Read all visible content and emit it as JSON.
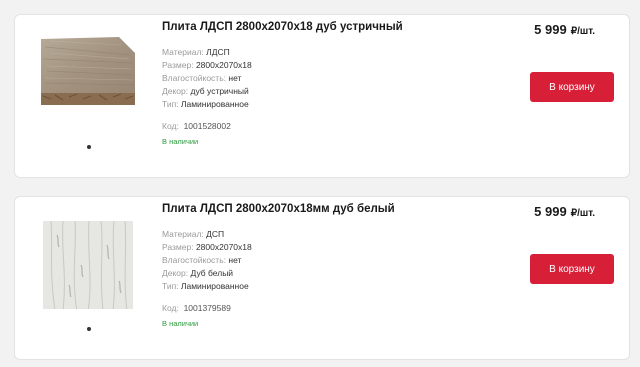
{
  "products": [
    {
      "title": "Плита ЛДСП 2800х2070х18 дуб устричный",
      "specs": [
        {
          "key": "Материал:",
          "value": "ЛДСП"
        },
        {
          "key": "Размер:",
          "value": "2800х2070х18"
        },
        {
          "key": "Влагостойкость:",
          "value": "нет"
        },
        {
          "key": "Декор:",
          "value": "дуб устричный"
        },
        {
          "key": "Тип:",
          "value": "Ламинированное"
        }
      ],
      "code_label": "Код:",
      "code_value": "1001528002",
      "stock": "В наличии",
      "price": "5 999",
      "unit": "₽/шт.",
      "button": "В корзину"
    },
    {
      "title": "Плита ЛДСП 2800х2070х18мм дуб белый",
      "specs": [
        {
          "key": "Материал:",
          "value": "ДСП"
        },
        {
          "key": "Размер:",
          "value": "2800х2070х18"
        },
        {
          "key": "Влагостойкость:",
          "value": "нет"
        },
        {
          "key": "Декор:",
          "value": "Дуб белый"
        },
        {
          "key": "Тип:",
          "value": "Ламинированное"
        }
      ],
      "code_label": "Код:",
      "code_value": "1001379589",
      "stock": "В наличии",
      "price": "5 999",
      "unit": "₽/шт.",
      "button": "В корзину"
    }
  ],
  "colors": {
    "accent": "#d71f37",
    "in_stock": "#2e9a3e"
  }
}
